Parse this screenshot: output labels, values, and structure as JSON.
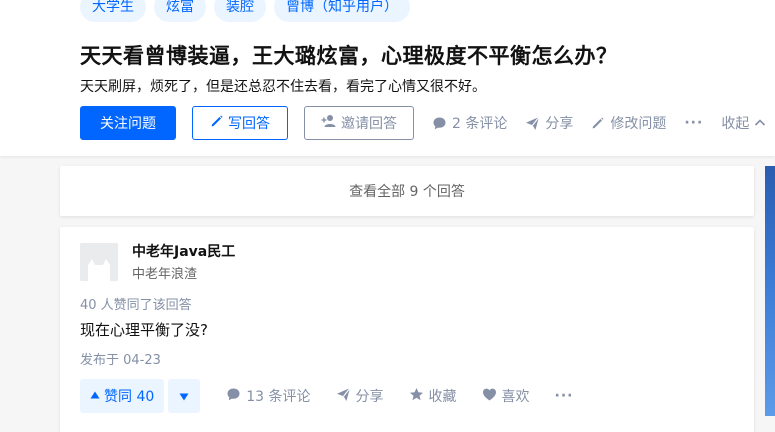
{
  "question": {
    "tags": [
      "大学生",
      "炫富",
      "装腔",
      "曾博（知乎用户）"
    ],
    "title": "天天看曾博装逼，王大璐炫富，心理极度不平衡怎么办？",
    "detail": "天天刷屏，烦死了，但是还总忍不住去看，看完了心情又很不好。",
    "follow_label": "关注问题",
    "write_label": "写回答",
    "invite_label": "邀请回答",
    "comments_label": "2 条评论",
    "share_label": "分享",
    "edit_label": "修改问题",
    "more_label": "···",
    "collapse_label": "收起"
  },
  "view_all_label": "查看全部 9 个回答",
  "answer": {
    "author_name": "中老年Java民工",
    "author_bio": "中老年浪渣",
    "vote_info": "40 人赞同了该回答",
    "content": "现在心理平衡了没?",
    "published": "发布于 04-23",
    "upvote_label": "赞同 40",
    "comments_label": "13 条评论",
    "share_label": "分享",
    "favorite_label": "收藏",
    "like_label": "喜欢",
    "more_label": "···"
  },
  "colors": {
    "brand": "#0066ff",
    "muted": "#8590a6",
    "tag_bg": "#ebf5ff"
  },
  "icons": [
    "pencil-icon",
    "add-person-icon",
    "comment-icon",
    "share-icon",
    "edit-icon",
    "more-icon",
    "chevron-up-icon",
    "triangle-up-icon",
    "triangle-down-icon",
    "star-icon",
    "heart-icon"
  ]
}
